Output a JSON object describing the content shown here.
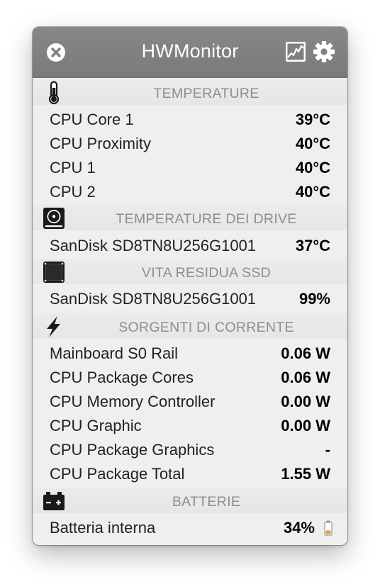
{
  "window": {
    "title": "HWMonitor"
  },
  "toolbar": {
    "close_icon": "close-icon",
    "graph_icon": "graph-icon",
    "settings_icon": "gear-icon"
  },
  "sections": [
    {
      "title": "TEMPERATURE",
      "icon": "thermometer-icon",
      "rows": [
        {
          "label": "CPU Core 1",
          "value": "39°C"
        },
        {
          "label": "CPU Proximity",
          "value": "40°C"
        },
        {
          "label": "CPU 1",
          "value": "40°C"
        },
        {
          "label": "CPU 2",
          "value": "40°C"
        }
      ]
    },
    {
      "title": "TEMPERATURE DEI DRIVE",
      "icon": "drive-icon",
      "rows": [
        {
          "label": "SanDisk SD8TN8U256G1001",
          "value": "37°C"
        }
      ]
    },
    {
      "title": "VITA RESIDUA SSD",
      "icon": "ssd-icon",
      "rows": [
        {
          "label": "SanDisk SD8TN8U256G1001",
          "value": "99%"
        }
      ]
    },
    {
      "title": "SORGENTI DI CORRENTE",
      "icon": "lightning-icon",
      "rows": [
        {
          "label": "Mainboard S0 Rail",
          "value": "0.06 W"
        },
        {
          "label": "CPU Package Cores",
          "value": "0.06 W"
        },
        {
          "label": "CPU Memory Controller",
          "value": "0.00 W"
        },
        {
          "label": "CPU Graphic",
          "value": "0.00 W"
        },
        {
          "label": "CPU Package Graphics",
          "value": "-"
        },
        {
          "label": "CPU Package Total",
          "value": "1.55 W"
        }
      ]
    },
    {
      "title": "BATTERIE",
      "icon": "battery-icon",
      "rows": [
        {
          "label": "Batteria interna",
          "value": "34%",
          "level": 0.34
        }
      ]
    }
  ],
  "colors": {
    "titlebar": "#808080",
    "panel_background": "#efefef",
    "section_header": "#e8e8e8",
    "section_title": "#8e8e8e",
    "battery_fill": "#d9a441"
  }
}
